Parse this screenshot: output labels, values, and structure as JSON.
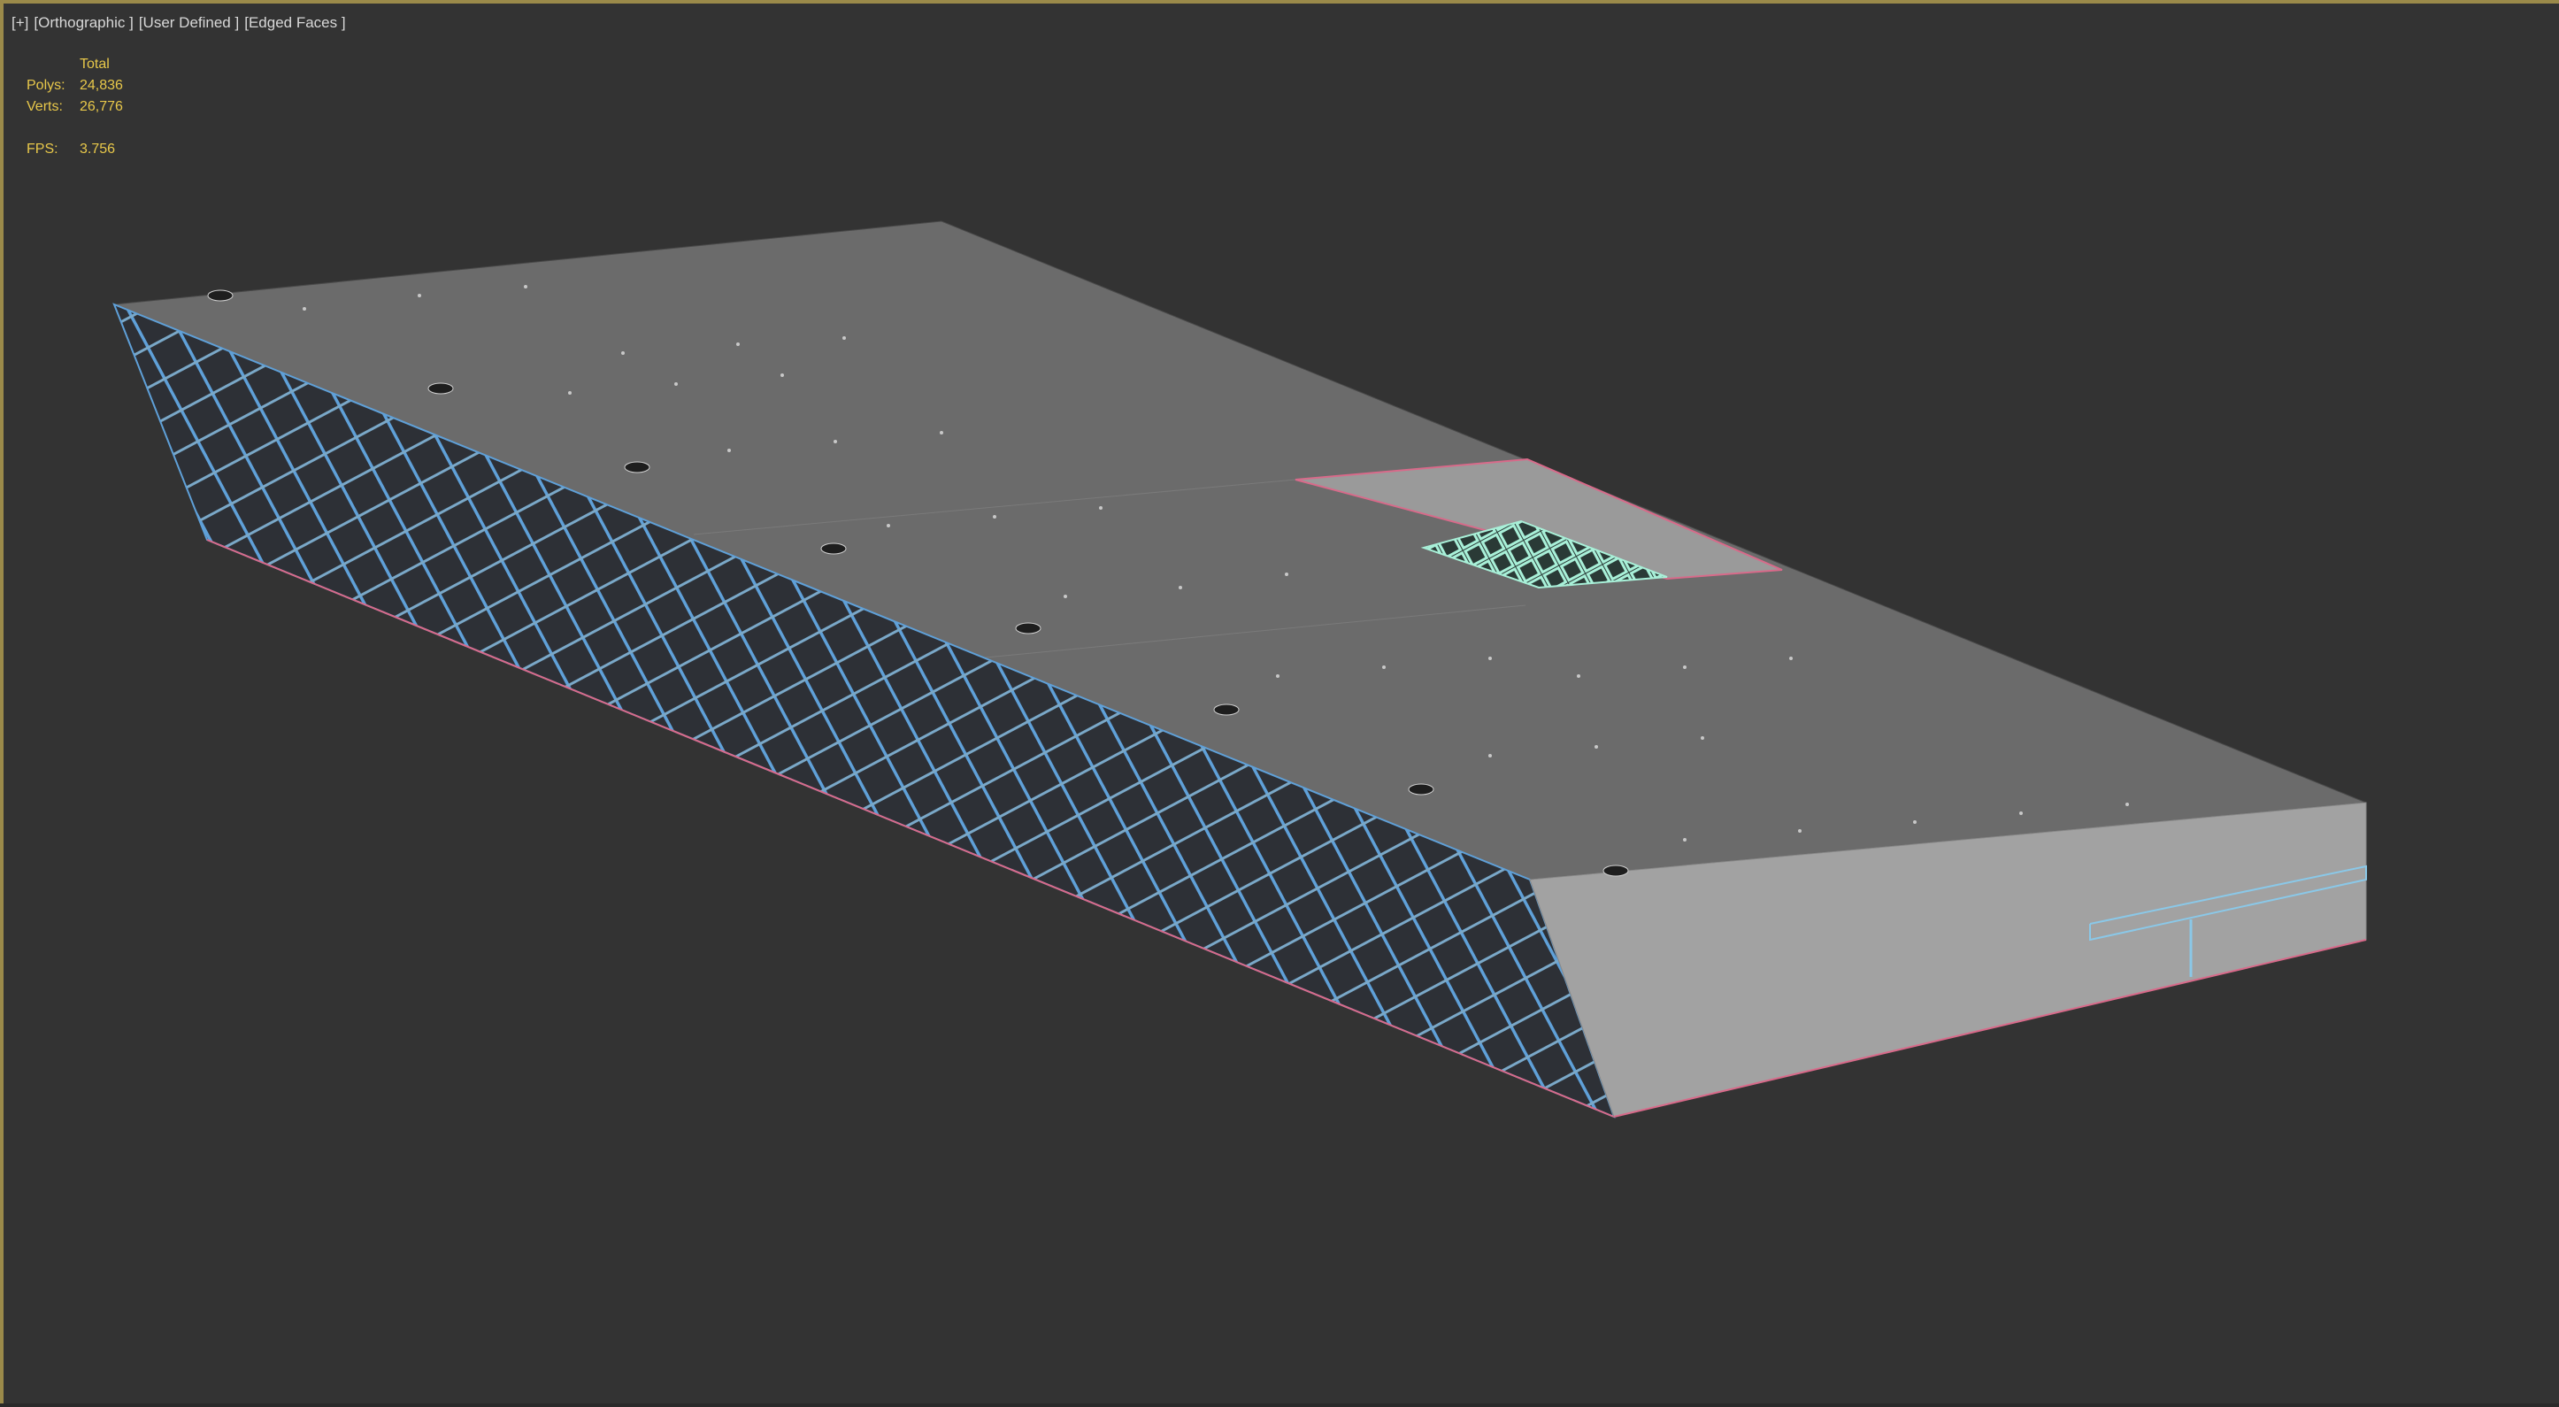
{
  "viewport": {
    "label_parts": [
      "[+]",
      "[Orthographic ]",
      "[User Defined ]",
      "[Edged Faces ]"
    ],
    "background": "#333333",
    "active_border_color": "#9b8a4a"
  },
  "stats": {
    "header": "Total",
    "polys_label": "Polys:",
    "polys_value": "24,836",
    "verts_label": "Verts:",
    "verts_value": "26,776",
    "fps_label": "FPS:",
    "fps_value": "3.756",
    "text_color": "#e8c84a"
  },
  "model": {
    "name": "building",
    "roof_color": "#6b6b6b",
    "end_face_color": "#a2a2a2",
    "glass_frame_color": "#5fa0d8",
    "wire_color": "#d86a8a",
    "skylight_color": "#9ef0d0"
  }
}
